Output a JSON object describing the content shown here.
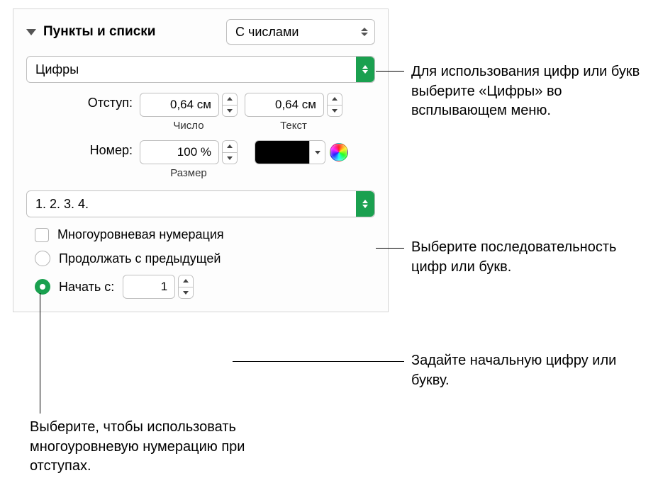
{
  "header": {
    "title": "Пункты и списки",
    "style_popup": "С числами"
  },
  "format_popup": "Цифры",
  "indent": {
    "label": "Отступ:",
    "number_value": "0,64 см",
    "number_sublabel": "Число",
    "text_value": "0,64 см",
    "text_sublabel": "Текст"
  },
  "number": {
    "label": "Номер:",
    "size_value": "100 %",
    "size_sublabel": "Размер"
  },
  "sequence_popup": "1. 2. 3. 4.",
  "tiered": {
    "label": "Многоуровневая нумерация"
  },
  "continue": {
    "label": "Продолжать с предыдущей"
  },
  "start": {
    "label": "Начать с:",
    "value": "1"
  },
  "callouts": {
    "format": "Для использования цифр или букв выберите «Цифры» во всплывающем меню.",
    "sequence": "Выберите последовательность цифр или букв.",
    "start": "Задайте начальную цифру или букву.",
    "tiered": "Выберите, чтобы использовать многоуровневую нумерацию при отступах."
  }
}
